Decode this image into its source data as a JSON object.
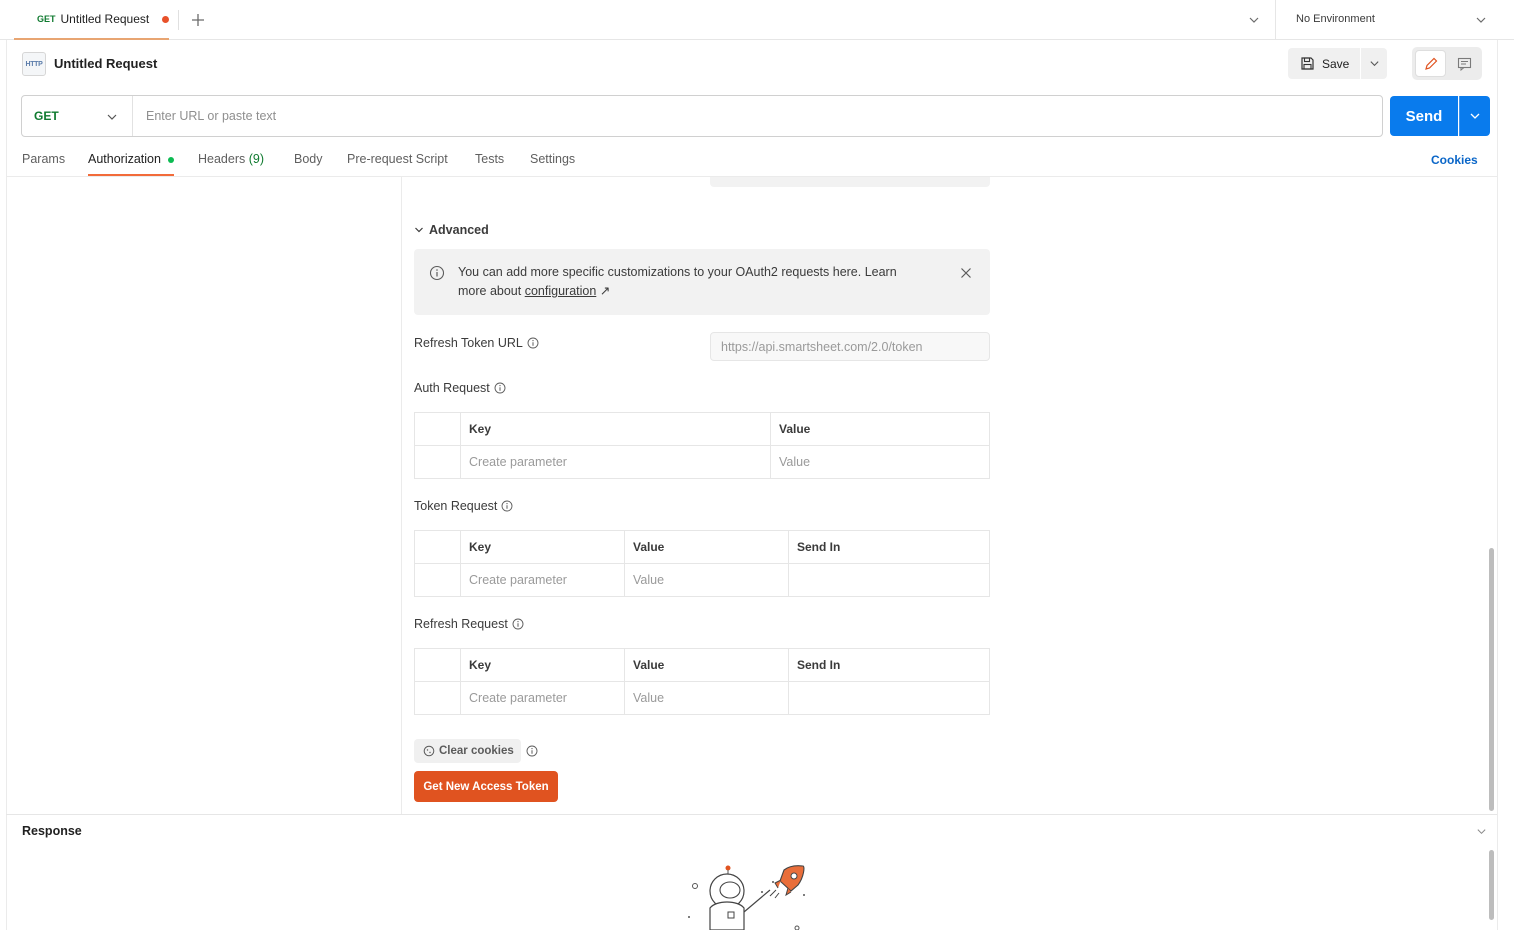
{
  "tab": {
    "method": "GET",
    "title": "Untitled Request"
  },
  "environment": {
    "label": "No Environment"
  },
  "header": {
    "http_badge": "HTTP",
    "title": "Untitled Request",
    "save_label": "Save"
  },
  "url_bar": {
    "method": "GET",
    "placeholder": "Enter URL or paste text",
    "value": "",
    "send_label": "Send"
  },
  "request_tabs": {
    "params": "Params",
    "authorization": "Authorization",
    "headers": "Headers",
    "headers_count": "(9)",
    "body": "Body",
    "pre_request": "Pre-request Script",
    "tests": "Tests",
    "settings": "Settings",
    "cookies": "Cookies"
  },
  "advanced": {
    "toggle_label": "Advanced",
    "info_text": "You can add more specific customizations to your OAuth2 requests here. Learn more about ",
    "info_link": "configuration",
    "info_link_arrow": "↗"
  },
  "refresh_token_url": {
    "label": "Refresh Token URL",
    "placeholder": "https://api.smartsheet.com/2.0/token"
  },
  "auth_request": {
    "label": "Auth Request",
    "columns": [
      "Key",
      "Value"
    ],
    "placeholders": [
      "Create parameter",
      "Value"
    ]
  },
  "token_request": {
    "label": "Token Request",
    "columns": [
      "Key",
      "Value",
      "Send In"
    ],
    "placeholders": [
      "Create parameter",
      "Value",
      ""
    ]
  },
  "refresh_request": {
    "label": "Refresh Request",
    "columns": [
      "Key",
      "Value",
      "Send In"
    ],
    "placeholders": [
      "Create parameter",
      "Value",
      ""
    ]
  },
  "actions": {
    "clear_cookies": "Clear cookies",
    "get_token": "Get New Access Token"
  },
  "response": {
    "title": "Response"
  },
  "colors": {
    "send": "#097bed",
    "get_token": "#e05320",
    "method_get": "#0f7a2f",
    "tab_active": "#f26b3a"
  }
}
